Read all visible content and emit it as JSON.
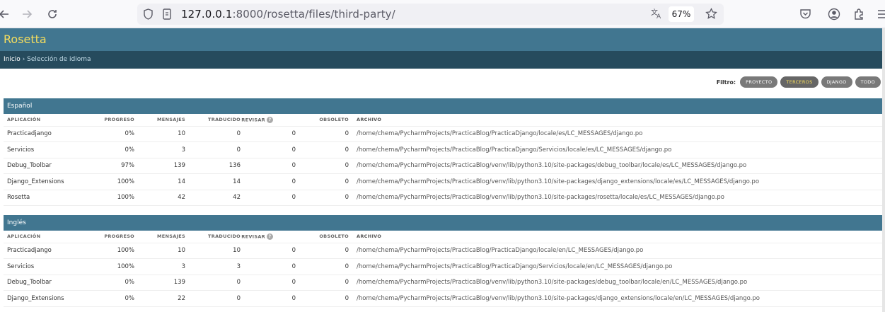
{
  "browser": {
    "url_host": "127.0.0.1",
    "url_rest": ":8000/rosetta/files/third-party/",
    "zoom": "67%"
  },
  "header": {
    "title": "Rosetta"
  },
  "breadcrumbs": {
    "home": "Inicio",
    "sep": " › ",
    "current": "Selección de idioma"
  },
  "filter": {
    "label": "Filtro:",
    "options": [
      "PROYECTO",
      "TERCEROS",
      "DJANGO",
      "TODO"
    ],
    "active": "TERCEROS"
  },
  "columns": [
    "APLICACIÓN",
    "PROGRESO",
    "MENSAJES",
    "TRADUCIDO",
    "REVISAR",
    "OBSOLETO",
    "ARCHIVO"
  ],
  "languages": [
    {
      "name": "Español",
      "rows": [
        [
          "Practicadjango",
          "0%",
          "10",
          "0",
          "0",
          "0",
          "/home/chema/PycharmProjects/PracticaBlog/PracticaDjango/locale/es/LC_MESSAGES/django.po"
        ],
        [
          "Servicios",
          "0%",
          "3",
          "0",
          "0",
          "0",
          "/home/chema/PycharmProjects/PracticaBlog/PracticaDjango/Servicios/locale/es/LC_MESSAGES/django.po"
        ],
        [
          "Debug_Toolbar",
          "97%",
          "139",
          "136",
          "0",
          "0",
          "/home/chema/PycharmProjects/PracticaBlog/venv/lib/python3.10/site-packages/debug_toolbar/locale/es/LC_MESSAGES/django.po"
        ],
        [
          "Django_Extensions",
          "100%",
          "14",
          "14",
          "0",
          "0",
          "/home/chema/PycharmProjects/PracticaBlog/venv/lib/python3.10/site-packages/django_extensions/locale/es/LC_MESSAGES/django.po"
        ],
        [
          "Rosetta",
          "100%",
          "42",
          "42",
          "0",
          "0",
          "/home/chema/PycharmProjects/PracticaBlog/venv/lib/python3.10/site-packages/rosetta/locale/es/LC_MESSAGES/django.po"
        ]
      ]
    },
    {
      "name": "Inglés",
      "rows": [
        [
          "Practicadjango",
          "100%",
          "10",
          "10",
          "0",
          "0",
          "/home/chema/PycharmProjects/PracticaBlog/PracticaDjango/locale/en/LC_MESSAGES/django.po"
        ],
        [
          "Servicios",
          "100%",
          "3",
          "3",
          "0",
          "0",
          "/home/chema/PycharmProjects/PracticaBlog/PracticaDjango/Servicios/locale/en/LC_MESSAGES/django.po"
        ],
        [
          "Debug_Toolbar",
          "0%",
          "139",
          "0",
          "0",
          "0",
          "/home/chema/PycharmProjects/PracticaBlog/venv/lib/python3.10/site-packages/debug_toolbar/locale/en/LC_MESSAGES/django.po"
        ],
        [
          "Django_Extensions",
          "0%",
          "22",
          "0",
          "0",
          "0",
          "/home/chema/PycharmProjects/PracticaBlog/venv/lib/python3.10/site-packages/django_extensions/locale/en/LC_MESSAGES/django.po"
        ]
      ]
    }
  ]
}
